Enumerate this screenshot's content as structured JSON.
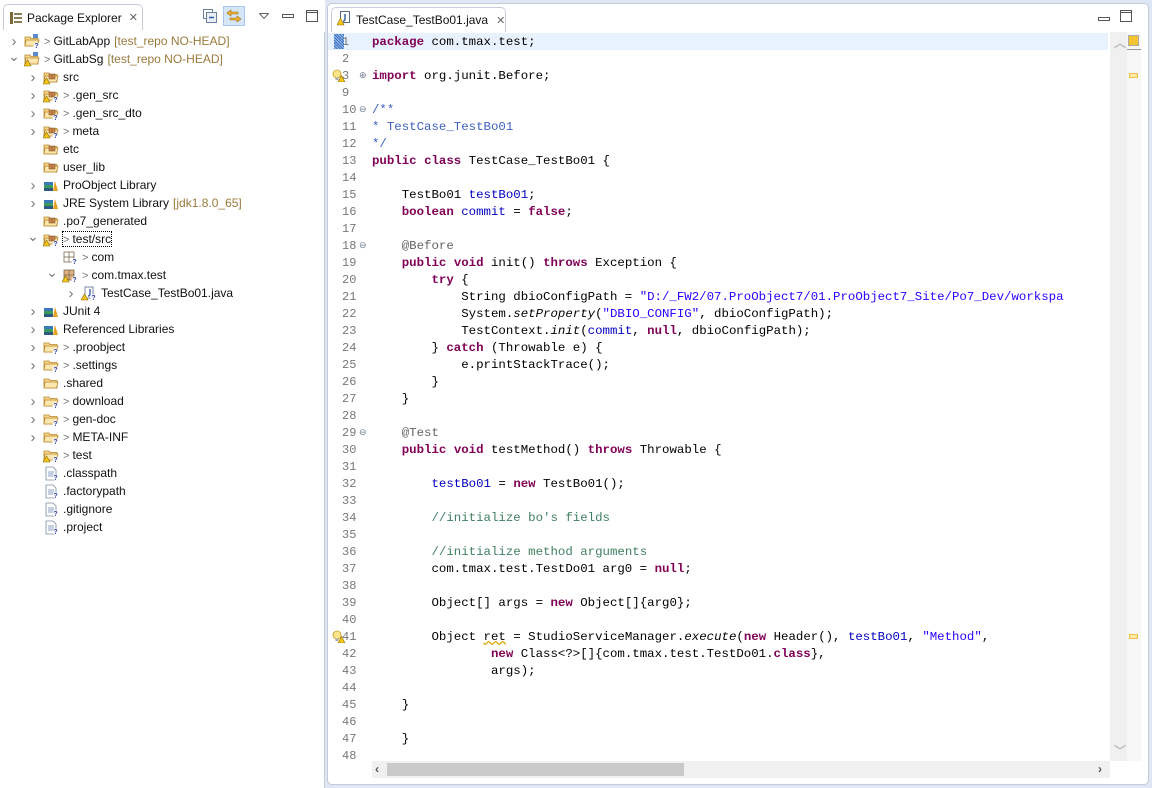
{
  "package_explorer": {
    "title": "Package Explorer",
    "close_glyph": "✕",
    "toolbar": {
      "collapse_all": "collapse-all-icon",
      "link_with_editor": "link-with-editor-icon",
      "view_menu": "view-menu-icon",
      "minimize": "minimize-icon",
      "maximize": "maximize-icon"
    },
    "tree": [
      {
        "depth": 0,
        "twisty": "collapsed",
        "icon": "project-folder-unknown-icon",
        "dirty": true,
        "label": "GitLabApp",
        "extra": "[test_repo NO-HEAD]"
      },
      {
        "depth": 0,
        "twisty": "expanded",
        "icon": "project-folder-warning-icon",
        "dirty": true,
        "label": "GitLabSg",
        "extra": "[test_repo NO-HEAD]"
      },
      {
        "depth": 1,
        "twisty": "collapsed",
        "icon": "source-folder-warning-icon",
        "dirty": false,
        "label": "src",
        "extra": ""
      },
      {
        "depth": 1,
        "twisty": "collapsed",
        "icon": "source-folder-warning-unknown-icon",
        "dirty": true,
        "label": ".gen_src",
        "extra": ""
      },
      {
        "depth": 1,
        "twisty": "collapsed",
        "icon": "source-folder-unknown-icon",
        "dirty": true,
        "label": ".gen_src_dto",
        "extra": ""
      },
      {
        "depth": 1,
        "twisty": "collapsed",
        "icon": "source-folder-warning-unknown-icon",
        "dirty": true,
        "label": "meta",
        "extra": ""
      },
      {
        "depth": 1,
        "twisty": "none",
        "icon": "source-folder-icon",
        "dirty": false,
        "label": "etc",
        "extra": ""
      },
      {
        "depth": 1,
        "twisty": "none",
        "icon": "source-folder-icon",
        "dirty": false,
        "label": "user_lib",
        "extra": ""
      },
      {
        "depth": 1,
        "twisty": "collapsed",
        "icon": "library-icon",
        "dirty": false,
        "label": "ProObject Library",
        "extra": ""
      },
      {
        "depth": 1,
        "twisty": "collapsed",
        "icon": "library-icon",
        "dirty": false,
        "label": "JRE System Library",
        "extra": "[jdk1.8.0_65]"
      },
      {
        "depth": 1,
        "twisty": "none",
        "icon": "source-folder-icon",
        "dirty": false,
        "label": ".po7_generated",
        "extra": ""
      },
      {
        "depth": 1,
        "twisty": "expanded",
        "icon": "source-folder-warning-unknown-icon",
        "dirty": true,
        "label": "test/src",
        "extra": "",
        "focused": true
      },
      {
        "depth": 2,
        "twisty": "none",
        "icon": "package-unknown-icon",
        "dirty": true,
        "label": "com",
        "extra": ""
      },
      {
        "depth": 2,
        "twisty": "expanded",
        "icon": "package-warning-unknown-icon",
        "dirty": true,
        "label": "com.tmax.test",
        "extra": ""
      },
      {
        "depth": 3,
        "twisty": "collapsed",
        "icon": "java-file-warning-unknown-icon",
        "dirty": false,
        "label": "TestCase_TestBo01.java",
        "extra": ""
      },
      {
        "depth": 1,
        "twisty": "collapsed",
        "icon": "library-icon",
        "dirty": false,
        "label": "JUnit 4",
        "extra": ""
      },
      {
        "depth": 1,
        "twisty": "collapsed",
        "icon": "library-icon",
        "dirty": false,
        "label": "Referenced Libraries",
        "extra": ""
      },
      {
        "depth": 1,
        "twisty": "collapsed",
        "icon": "folder-unknown-icon",
        "dirty": true,
        "label": ".proobject",
        "extra": ""
      },
      {
        "depth": 1,
        "twisty": "collapsed",
        "icon": "folder-unknown-icon",
        "dirty": true,
        "label": ".settings",
        "extra": ""
      },
      {
        "depth": 1,
        "twisty": "none",
        "icon": "folder-icon",
        "dirty": false,
        "label": ".shared",
        "extra": ""
      },
      {
        "depth": 1,
        "twisty": "collapsed",
        "icon": "folder-unknown-icon",
        "dirty": true,
        "label": "download",
        "extra": ""
      },
      {
        "depth": 1,
        "twisty": "collapsed",
        "icon": "folder-unknown-icon",
        "dirty": true,
        "label": "gen-doc",
        "extra": ""
      },
      {
        "depth": 1,
        "twisty": "collapsed",
        "icon": "folder-unknown-icon",
        "dirty": true,
        "label": "META-INF",
        "extra": ""
      },
      {
        "depth": 1,
        "twisty": "none",
        "icon": "folder-warning-unknown-icon",
        "dirty": true,
        "label": "test",
        "extra": ""
      },
      {
        "depth": 1,
        "twisty": "none",
        "icon": "file-unknown-icon",
        "dirty": false,
        "label": ".classpath",
        "extra": ""
      },
      {
        "depth": 1,
        "twisty": "none",
        "icon": "file-unknown-icon",
        "dirty": false,
        "label": ".factorypath",
        "extra": ""
      },
      {
        "depth": 1,
        "twisty": "none",
        "icon": "file-unknown-icon",
        "dirty": false,
        "label": ".gitignore",
        "extra": ""
      },
      {
        "depth": 1,
        "twisty": "none",
        "icon": "file-unknown-icon",
        "dirty": false,
        "label": ".project",
        "extra": ""
      }
    ],
    "dirty_prefix": ">"
  },
  "editor": {
    "tab_label": "TestCase_TestBo01.java",
    "tab_icon": "java-file-warning-icon",
    "close_glyph": "✕",
    "window_buttons": [
      "minimize-icon",
      "maximize-icon"
    ],
    "current_line": 1,
    "lines": [
      {
        "n": "1",
        "fold": "",
        "ann": "",
        "tokens": [
          [
            "kw",
            "package"
          ],
          [
            "",
            "com.tmax.test;"
          ]
        ]
      },
      {
        "n": "2",
        "fold": "",
        "ann": "",
        "tokens": []
      },
      {
        "n": "3",
        "fold": "⊕",
        "ann": "warning-bulb-icon",
        "tokens": [
          [
            "kw",
            "import"
          ],
          [
            "",
            " org.junit.Before;"
          ]
        ]
      },
      {
        "n": "9",
        "fold": "",
        "ann": "",
        "tokens": []
      },
      {
        "n": "10",
        "fold": "⊖",
        "ann": "",
        "tokens": [
          [
            "jd",
            "/**"
          ]
        ]
      },
      {
        "n": "11",
        "fold": "",
        "ann": "",
        "tokens": [
          [
            "jd",
            "* TestCase_TestBo01"
          ]
        ]
      },
      {
        "n": "12",
        "fold": "",
        "ann": "",
        "tokens": [
          [
            "jd",
            "*/"
          ]
        ]
      },
      {
        "n": "13",
        "fold": "",
        "ann": "",
        "tokens": [
          [
            "kw",
            "public"
          ],
          [
            "",
            " "
          ],
          [
            "kw",
            "class"
          ],
          [
            "",
            " TestCase_TestBo01 {"
          ]
        ]
      },
      {
        "n": "14",
        "fold": "",
        "ann": "",
        "tokens": []
      },
      {
        "n": "15",
        "fold": "",
        "ann": "",
        "tokens": [
          [
            "",
            "    TestBo01 "
          ],
          [
            "fld",
            "testBo01"
          ],
          [
            "",
            ";"
          ]
        ]
      },
      {
        "n": "16",
        "fold": "",
        "ann": "",
        "tokens": [
          [
            "",
            "    "
          ],
          [
            "kw",
            "boolean"
          ],
          [
            "",
            " "
          ],
          [
            "fld",
            "commit"
          ],
          [
            "",
            " = "
          ],
          [
            "kw",
            "false"
          ],
          [
            "",
            ";"
          ]
        ]
      },
      {
        "n": "17",
        "fold": "",
        "ann": "",
        "tokens": []
      },
      {
        "n": "18",
        "fold": "⊖",
        "ann": "",
        "tokens": [
          [
            "",
            "    "
          ],
          [
            "anno",
            "@Before"
          ]
        ]
      },
      {
        "n": "19",
        "fold": "",
        "ann": "",
        "tokens": [
          [
            "",
            "    "
          ],
          [
            "kw",
            "public"
          ],
          [
            "",
            " "
          ],
          [
            "kw",
            "void"
          ],
          [
            "",
            " init() "
          ],
          [
            "kw",
            "throws"
          ],
          [
            "",
            " Exception {"
          ]
        ]
      },
      {
        "n": "20",
        "fold": "",
        "ann": "",
        "tokens": [
          [
            "",
            "        "
          ],
          [
            "kw",
            "try"
          ],
          [
            "",
            " {"
          ]
        ]
      },
      {
        "n": "21",
        "fold": "",
        "ann": "",
        "tokens": [
          [
            "",
            "            String dbioConfigPath = "
          ],
          [
            "str",
            "\"D:/_FW2/07.ProObject7/01.ProObject7_Site/Po7_Dev/workspa"
          ]
        ]
      },
      {
        "n": "22",
        "fold": "",
        "ann": "",
        "tokens": [
          [
            "",
            "            System."
          ],
          [
            "it",
            "setProperty"
          ],
          [
            "",
            "("
          ],
          [
            "str",
            "\"DBIO_CONFIG\""
          ],
          [
            "",
            ", dbioConfigPath);"
          ]
        ]
      },
      {
        "n": "23",
        "fold": "",
        "ann": "",
        "tokens": [
          [
            "",
            "            TestContext."
          ],
          [
            "it",
            "init"
          ],
          [
            "",
            "("
          ],
          [
            "fld",
            "commit"
          ],
          [
            "",
            ", "
          ],
          [
            "kw",
            "null"
          ],
          [
            "",
            ", dbioConfigPath);"
          ]
        ]
      },
      {
        "n": "24",
        "fold": "",
        "ann": "",
        "tokens": [
          [
            "",
            "        } "
          ],
          [
            "kw",
            "catch"
          ],
          [
            "",
            " (Throwable e) {"
          ]
        ]
      },
      {
        "n": "25",
        "fold": "",
        "ann": "",
        "tokens": [
          [
            "",
            "            e.printStackTrace();"
          ]
        ]
      },
      {
        "n": "26",
        "fold": "",
        "ann": "",
        "tokens": [
          [
            "",
            "        }"
          ]
        ]
      },
      {
        "n": "27",
        "fold": "",
        "ann": "",
        "tokens": [
          [
            "",
            "    }"
          ]
        ]
      },
      {
        "n": "28",
        "fold": "",
        "ann": "",
        "tokens": []
      },
      {
        "n": "29",
        "fold": "⊖",
        "ann": "",
        "tokens": [
          [
            "",
            "    "
          ],
          [
            "anno",
            "@Test"
          ]
        ]
      },
      {
        "n": "30",
        "fold": "",
        "ann": "",
        "tokens": [
          [
            "",
            "    "
          ],
          [
            "kw",
            "public"
          ],
          [
            "",
            " "
          ],
          [
            "kw",
            "void"
          ],
          [
            "",
            " testMethod() "
          ],
          [
            "kw",
            "throws"
          ],
          [
            "",
            " Throwable {"
          ]
        ]
      },
      {
        "n": "31",
        "fold": "",
        "ann": "",
        "tokens": []
      },
      {
        "n": "32",
        "fold": "",
        "ann": "",
        "tokens": [
          [
            "",
            "        "
          ],
          [
            "fld",
            "testBo01"
          ],
          [
            "",
            " = "
          ],
          [
            "kw",
            "new"
          ],
          [
            "",
            " TestBo01();"
          ]
        ]
      },
      {
        "n": "33",
        "fold": "",
        "ann": "",
        "tokens": []
      },
      {
        "n": "34",
        "fold": "",
        "ann": "",
        "tokens": [
          [
            "",
            "        "
          ],
          [
            "cmt",
            "//initialize bo's fields"
          ]
        ]
      },
      {
        "n": "35",
        "fold": "",
        "ann": "",
        "tokens": []
      },
      {
        "n": "36",
        "fold": "",
        "ann": "",
        "tokens": [
          [
            "",
            "        "
          ],
          [
            "cmt",
            "//initialize method arguments"
          ]
        ]
      },
      {
        "n": "37",
        "fold": "",
        "ann": "",
        "tokens": [
          [
            "",
            "        com.tmax.test.TestDo01 arg0 = "
          ],
          [
            "kw",
            "null"
          ],
          [
            "",
            ";"
          ]
        ]
      },
      {
        "n": "38",
        "fold": "",
        "ann": "",
        "tokens": []
      },
      {
        "n": "39",
        "fold": "",
        "ann": "",
        "tokens": [
          [
            "",
            "        Object[] args = "
          ],
          [
            "kw",
            "new"
          ],
          [
            "",
            " Object[]{arg0};"
          ]
        ]
      },
      {
        "n": "40",
        "fold": "",
        "ann": "",
        "tokens": []
      },
      {
        "n": "41",
        "fold": "",
        "ann": "warning-bulb-icon",
        "tokens": [
          [
            "",
            "        Object "
          ],
          [
            "warn",
            "ret"
          ],
          [
            "",
            " = StudioServiceManager."
          ],
          [
            "it",
            "execute"
          ],
          [
            "",
            "("
          ],
          [
            "kw",
            "new"
          ],
          [
            "",
            " Header(), "
          ],
          [
            "fld",
            "testBo01"
          ],
          [
            "",
            ", "
          ],
          [
            "str",
            "\"Method\""
          ],
          [
            "",
            ","
          ]
        ]
      },
      {
        "n": "42",
        "fold": "",
        "ann": "",
        "tokens": [
          [
            "",
            "                "
          ],
          [
            "kw",
            "new"
          ],
          [
            "",
            " Class<?>[]{com.tmax.test.TestDo01."
          ],
          [
            "kw",
            "class"
          ],
          [
            "",
            "},"
          ]
        ]
      },
      {
        "n": "43",
        "fold": "",
        "ann": "",
        "tokens": [
          [
            "",
            "                args);"
          ]
        ]
      },
      {
        "n": "44",
        "fold": "",
        "ann": "",
        "tokens": []
      },
      {
        "n": "45",
        "fold": "",
        "ann": "",
        "tokens": [
          [
            "",
            "    }"
          ]
        ]
      },
      {
        "n": "46",
        "fold": "",
        "ann": "",
        "tokens": []
      },
      {
        "n": "47",
        "fold": "",
        "ann": "",
        "tokens": [
          [
            "",
            "    }"
          ]
        ]
      },
      {
        "n": "48",
        "fold": "",
        "ann": "",
        "tokens": []
      }
    ],
    "hscroll": {
      "position": 0.0,
      "visible_fraction": 0.42,
      "left_arrow": "‹",
      "right_arrow": "›"
    },
    "vscroll": {
      "up_arrow": "^",
      "down_arrow": "v"
    },
    "overview_markers": [
      "warning-marker",
      "warning-marker"
    ]
  }
}
